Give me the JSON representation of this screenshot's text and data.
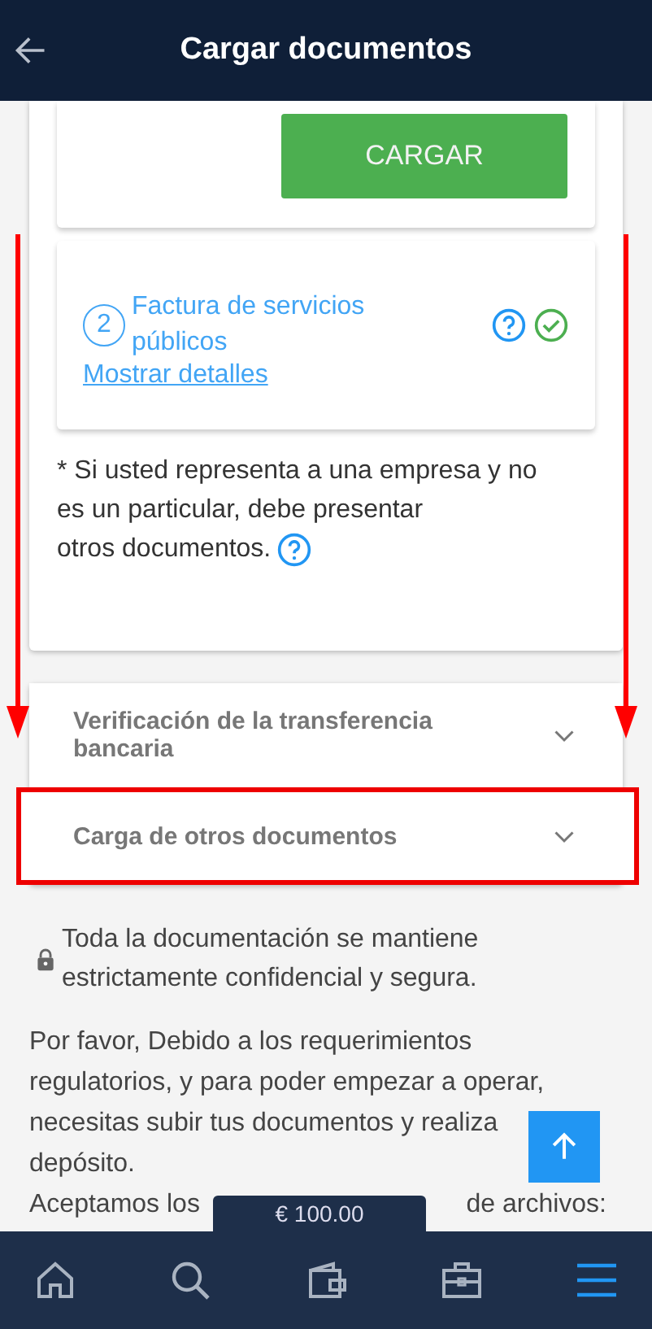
{
  "header": {
    "title": "Cargar documentos"
  },
  "upload_button": "CARGAR",
  "documents": [
    {
      "number": "2",
      "title": "Factura de servicios públicos",
      "link": "Mostrar detalles",
      "verified": true
    }
  ],
  "note": [
    "* Si usted representa a una empresa y no es un particular, debe presentar",
    "otros documentos."
  ],
  "sections": [
    {
      "title": "Verificación de la transferencia bancaria",
      "expanded": false,
      "highlighted": false
    },
    {
      "title": "Carga de otros documentos",
      "expanded": false,
      "highlighted": true
    }
  ],
  "security_note": "Toda la documentación se mantiene estrictamente confidencial y segura.",
  "paragraph": "Por favor, Debido a los requerimientos regulatorios, y para poder empezar a operar, necesitas subir tus documentos y realiza",
  "paragraph_end": "depósito.",
  "accepted_text": [
    "Aceptamos los",
    "de archivos:"
  ],
  "balance": "€ 100.00",
  "annotations": [
    {
      "kind": "arrow"
    },
    {
      "kind": "arrow"
    }
  ],
  "nav": [
    {
      "kind": "home",
      "selected": false
    },
    {
      "kind": "search",
      "selected": false
    },
    {
      "kind": "wallet",
      "selected": false
    },
    {
      "kind": "briefcase",
      "selected": false
    },
    {
      "kind": "menu",
      "selected": true
    }
  ]
}
